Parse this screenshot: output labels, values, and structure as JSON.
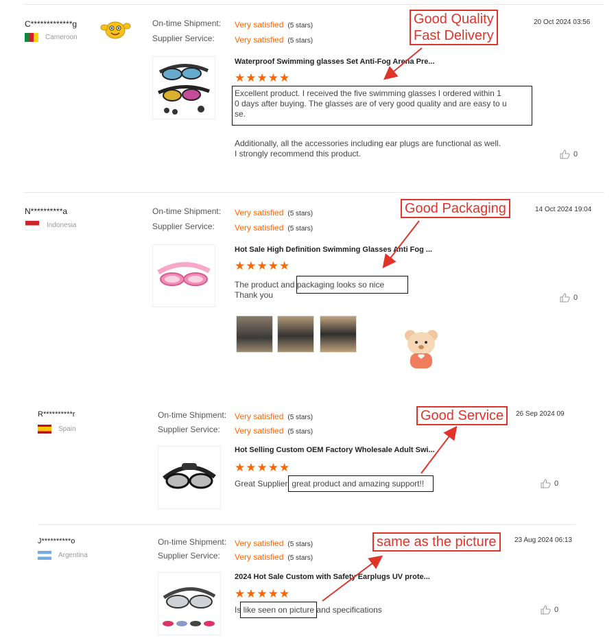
{
  "reviews": [
    {
      "name": "C*************g",
      "country": "Cameroon",
      "shipment_label": "On-time Shipment:",
      "service_label": "Supplier Service:",
      "shipment_value": "Very satisfied",
      "service_value": "Very satisfied",
      "stars_text": "(5 stars)",
      "product_title": "Waterproof Swimming glasses Set Anti-Fog Arena Pre...",
      "rating": "★★★★★",
      "text_part1": "Excellent product. I received the five swimming glasses I ordered within 1",
      "text_part2": "0 days after buying. The glasses are of very good quality and are easy to u",
      "text_part3": "se.",
      "text_extra1": "Additionally, all the accessories including ear plugs are functional as well.",
      "text_extra2": "I strongly recommend this product.",
      "date": "20 Oct 2024 03:56",
      "likes": "0",
      "callout": [
        "Good Quality",
        "Fast Delivery"
      ]
    },
    {
      "name": "N**********a",
      "country": "Indonesia",
      "shipment_label": "On-time Shipment:",
      "service_label": "Supplier Service:",
      "shipment_value": "Very satisfied",
      "service_value": "Very satisfied",
      "stars_text": "(5 stars)",
      "product_title": "Hot Sale High Definition Swimming Glasses Anti Fog ...",
      "rating": "★★★★★",
      "text_pre": "The product and ",
      "text_box": "packaging looks so nice",
      "text_line2": "Thank you",
      "date": "14 Oct 2024 19:04",
      "likes": "0",
      "callout": "Good Packaging"
    },
    {
      "name": "R**********r",
      "country": "Spain",
      "shipment_label": "On-time Shipment:",
      "service_label": "Supplier Service:",
      "shipment_value": "Very satisfied",
      "service_value": "Very satisfied",
      "stars_text": "(5 stars)",
      "product_title": "Hot Selling Custom OEM Factory Wholesale Adult Swi...",
      "rating": "★★★★★",
      "text_pre": "Great Supplier, ",
      "text_box": "great product and amazing support!!",
      "date": "26 Sep 2024 09",
      "likes": "0",
      "callout": "Good Service"
    },
    {
      "name": "J**********o",
      "country": "Argentina",
      "shipment_label": "On-time Shipment:",
      "service_label": "Supplier Service:",
      "shipment_value": "Very satisfied",
      "service_value": "Very satisfied",
      "stars_text": "(5 stars)",
      "product_title": "2024 Hot Sale Custom with Safety Earplugs UV prote...",
      "rating": "★★★★★",
      "text_pre": "Is ",
      "text_box": "like seen on picture",
      "text_post": " and specifications",
      "date": "23 Aug 2024 06:13",
      "likes": "0",
      "callout": "same as the picture"
    }
  ],
  "icons": {
    "like": "thumbs-up-icon",
    "arrow": "red-arrow"
  },
  "colors": {
    "accent": "#ff6600",
    "callout": "#e0342b"
  }
}
